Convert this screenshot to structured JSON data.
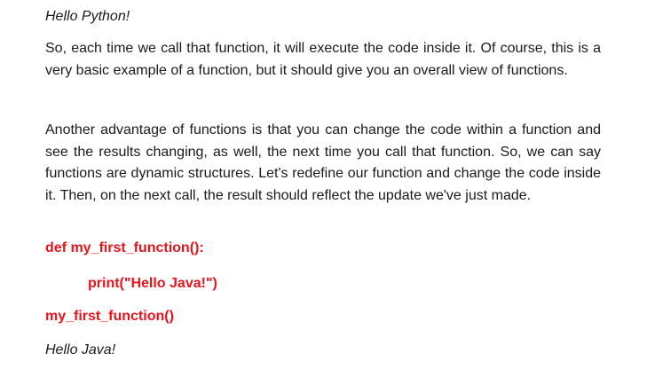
{
  "document": {
    "output_1": "Hello Python!",
    "paragraph_1": "So, each time we call that function, it will execute the code inside it. Of course, this is a very basic example of a function, but it should give you an overall view of functions.",
    "paragraph_2": "Another advantage of functions is that you can change the code within a function and see the results changing, as well, the next time you call that function. So, we can say functions are dynamic structures. Let's redefine our function and change the code inside it. Then, on the next call, the result should reflect the update we've just made.",
    "code_line_1": "def my_first_function():",
    "code_line_2": "print(\"Hello Java!\")",
    "code_line_3": "my_first_function()",
    "output_2": "Hello Java!"
  },
  "colors": {
    "code": "#e8141c",
    "text": "#1a1a1a"
  }
}
